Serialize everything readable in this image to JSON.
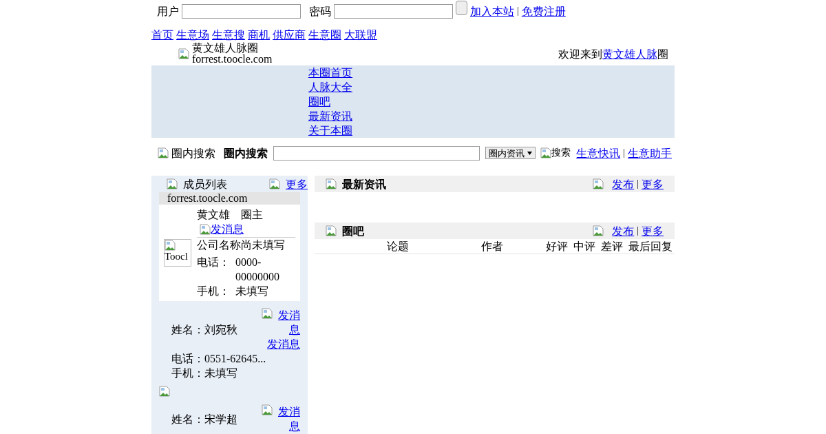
{
  "login": {
    "user_label": "用户",
    "password_label": "密码",
    "join_link": "加入本站",
    "separator": "|",
    "register_link": "免费注册"
  },
  "nav": [
    "首页",
    "生意场",
    "生意搜",
    "商机",
    "供应商",
    "生意圈",
    "大联盟"
  ],
  "header": {
    "circle_name": "黄文雄人脉圈",
    "domain": "forrest.toocle.com",
    "welcome": "欢迎来到",
    "welcome_link": "黄文雄人脉",
    "welcome_suffix": "圈"
  },
  "circle_menu": [
    "本圈首页",
    "人脉大全",
    "圈吧",
    "最新资讯",
    "关于本圈"
  ],
  "search": {
    "image_alt": "圈内搜索",
    "label": "圈内搜索",
    "scope": "圈内资讯",
    "button_alt": "搜索",
    "links": [
      "生意快讯",
      "生意助手"
    ],
    "separator": "|"
  },
  "members": {
    "title": "成员列表",
    "more": "更多",
    "owner": {
      "domain": "forrest.toocle.com",
      "name": "黄文雄",
      "role": "圈主",
      "photo_alt": "Toocl",
      "message_alt": "发消息",
      "company": "公司名称尚未填写",
      "phone_label": "电话：",
      "phone": "0000-00000000",
      "mobile_label": "手机：",
      "mobile": "未填写"
    },
    "list": [
      {
        "name": "姓名：刘宛秋",
        "message_alt": "发消息",
        "message_link": "发消息",
        "phone": "电话：0551-62645...",
        "mobile": "手机：未填写"
      },
      {
        "name": "姓名：宋学超",
        "message_alt": "发消息"
      }
    ]
  },
  "news": {
    "title": "最新资讯",
    "publish": "发布",
    "separator": "|",
    "more": "更多"
  },
  "forum": {
    "title": "圈吧",
    "publish": "发布",
    "separator": "|",
    "more": "更多",
    "columns": [
      "论题",
      "作者",
      "好评",
      "中评",
      "差评",
      "最后回复"
    ]
  }
}
